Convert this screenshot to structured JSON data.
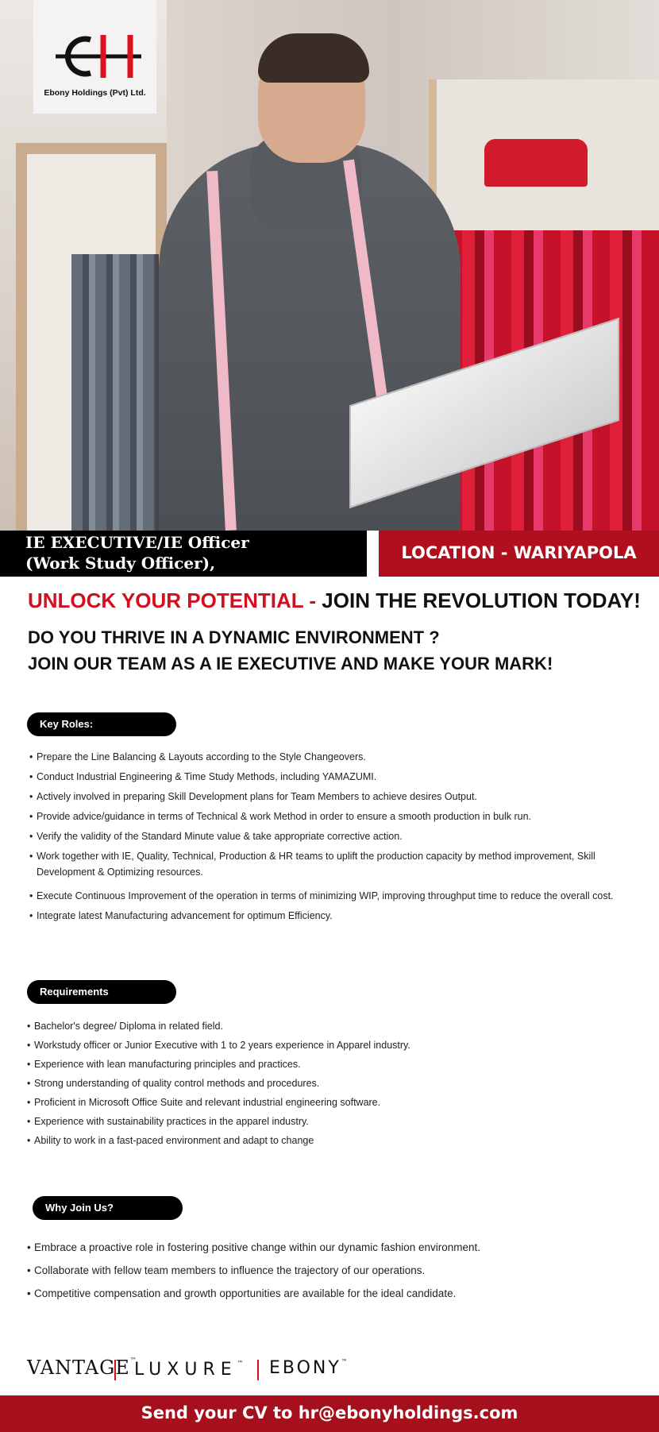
{
  "company": {
    "name": "Ebony Holdings (Pvt) Ltd."
  },
  "job": {
    "title_line1": "IE EXECUTIVE/IE Officer",
    "title_line2": "(Work Study Officer),",
    "location": "LOCATION - WARIYAPOLA"
  },
  "headline": {
    "red_part": "UNLOCK YOUR POTENTIAL -",
    "dark_part": " JOIN THE REVOLUTION TODAY!"
  },
  "subheadings": [
    "DO YOU THRIVE IN A DYNAMIC ENVIRONMENT ?",
    "JOIN OUR TEAM AS A IE EXECUTIVE AND MAKE YOUR MARK!"
  ],
  "sections": {
    "key_roles": {
      "label": "Key Roles:",
      "items": [
        "Prepare the Line Balancing & Layouts according to the Style Changeovers.",
        "Conduct Industrial Engineering & Time Study Methods, including YAMAZUMI.",
        "Actively involved in preparing Skill Development plans for Team Members to achieve desires Output.",
        "Provide advice/guidance in terms of Technical & work Method in order to ensure a smooth production in bulk run.",
        "Verify the validity of the Standard Minute value & take appropriate corrective action.",
        "Work together with IE, Quality, Technical, Production & HR teams to uplift the production capacity by method improvement, Skill Development & Optimizing resources.",
        "Execute Continuous Improvement of the operation in terms of minimizing WIP, improving throughput time to reduce the overall cost.",
        "Integrate latest Manufacturing advancement for optimum Efficiency."
      ]
    },
    "requirements": {
      "label": "Requirements",
      "items": [
        "Bachelor's degree/ Diploma in related field.",
        "Workstudy officer or Junior Executive with 1 to 2 years experience in Apparel industry.",
        "Experience with lean manufacturing principles and practices.",
        "Strong understanding of quality control methods and procedures.",
        "Proficient in Microsoft Office Suite and relevant industrial engineering software.",
        "Experience with sustainability practices in the apparel industry.",
        "Ability to work in a fast-paced environment and adapt to change"
      ]
    },
    "why_join": {
      "label": "Why Join Us?",
      "items": [
        "Embrace a proactive role in fostering positive change within our dynamic fashion environment.",
        "Collaborate with fellow team members to influence the trajectory of our operations.",
        "Competitive compensation and growth opportunities are available for the ideal candidate."
      ]
    }
  },
  "brands": {
    "vantage": "VANTAGE",
    "luxure": "LUXURE",
    "ebony": "EBONY",
    "tm": "™"
  },
  "footer": {
    "cta": "Send your CV to hr@ebonyholdings.com"
  },
  "colors": {
    "brand_red": "#d0101f",
    "banner_red": "#b0101e",
    "footer_red": "#a6101c",
    "black": "#000000"
  }
}
